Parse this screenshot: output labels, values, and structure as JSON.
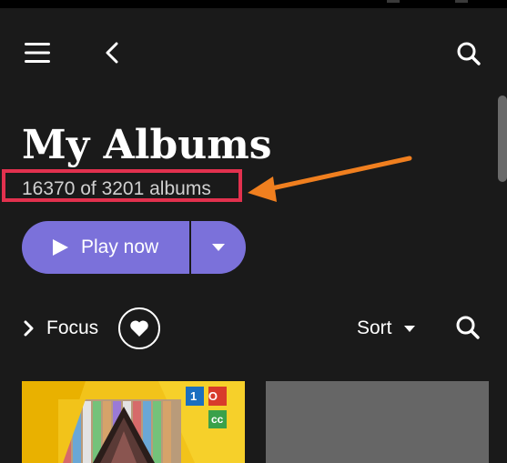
{
  "icons": {
    "menu": "hamburger-menu-icon",
    "back": "chevron-left-icon",
    "search": "search-icon",
    "play": "play-icon",
    "dropdown": "caret-down-icon",
    "focus_chevron": "chevron-right-icon",
    "favorite": "heart-icon",
    "sort_caret": "caret-down-icon"
  },
  "header": {
    "title": "My Albums",
    "count": "16370 of 3201 albums"
  },
  "actions": {
    "play_label": "Play now"
  },
  "filters": {
    "focus_label": "Focus",
    "sort_label": "Sort"
  },
  "colors": {
    "background": "#1a1a1a",
    "accent": "#7b71da",
    "highlight_box": "#e2314e",
    "annotation_arrow": "#f07f1f"
  },
  "albums": [
    {
      "art": "10cc-album-cover",
      "badge_top": "1 O",
      "badge_bottom": "cc"
    },
    {
      "art": "placeholder-cover"
    }
  ]
}
